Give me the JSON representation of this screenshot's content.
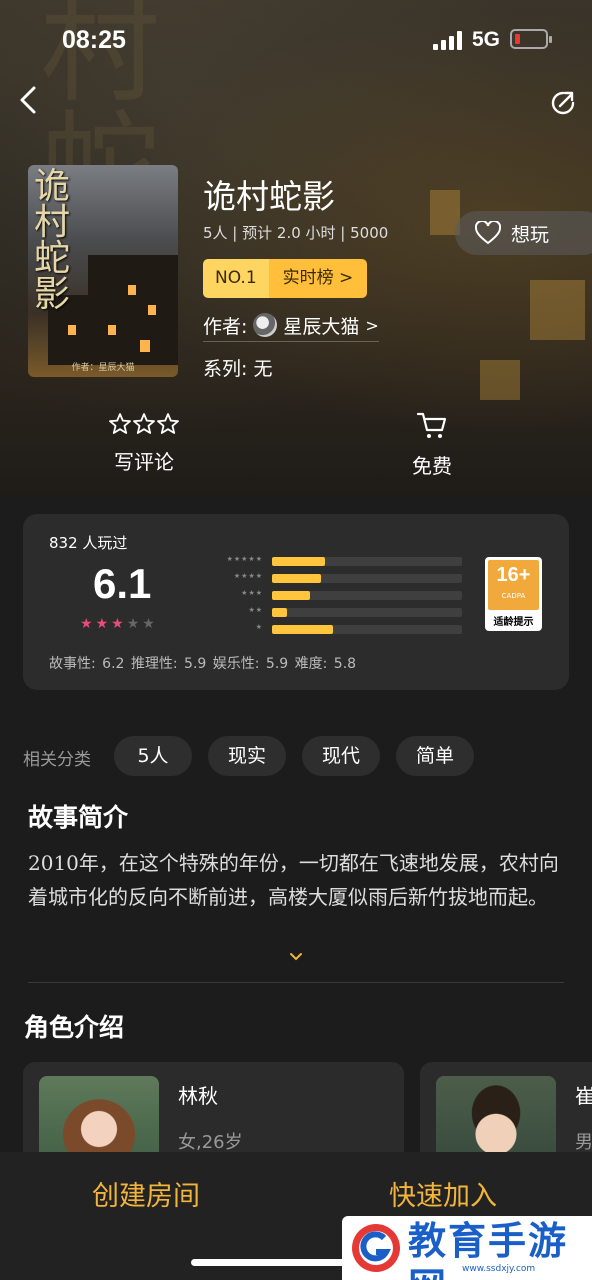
{
  "status_bar": {
    "time": "08:25",
    "network": "5G"
  },
  "game": {
    "title": "诡村蛇影",
    "cover_title": "诡村蛇影",
    "cover_author": "作者：星辰大猫",
    "meta": "5人 | 预计 2.0 小时 | 5000",
    "want_label": "想玩",
    "rank_no": "NO.1",
    "rank_board": "实时榜 >",
    "author_label": "作者:",
    "author_name": "星辰大猫",
    "author_arrow": ">",
    "series": "系列: 无"
  },
  "actions": {
    "review_label": "写评论",
    "price_label": "免费"
  },
  "rating": {
    "players": "832 人玩过",
    "score": "6.1",
    "stars": 3,
    "distribution": [
      {
        "stars": 5,
        "fraction": 0.28
      },
      {
        "stars": 4,
        "fraction": 0.26
      },
      {
        "stars": 3,
        "fraction": 0.2
      },
      {
        "stars": 2,
        "fraction": 0.08
      },
      {
        "stars": 1,
        "fraction": 0.32
      }
    ],
    "age": "16+",
    "age_org": "CADPA",
    "age_tip": "适龄提示",
    "sub_scores": "故事性: 6.2   推理性: 5.9   娱乐性: 5.9   难度: 5.8"
  },
  "categories": {
    "label": "相关分类",
    "tags": [
      "5人",
      "现实",
      "现代",
      "简单"
    ]
  },
  "synopsis": {
    "title": "故事简介",
    "text": "2010年，在这个特殊的年份，一切都在飞速地发展，农村向着城市化的反向不断前进，高楼大厦似雨后新竹拔地而起。"
  },
  "characters": {
    "title": "角色介绍",
    "items": [
      {
        "name": "林秋",
        "info": "女,26岁"
      },
      {
        "name": "崔",
        "info": "男"
      }
    ]
  },
  "bottom": {
    "create_room": "创建房间",
    "quick_join": "快速加入"
  },
  "watermark": {
    "text": "教育手游网",
    "url": "www.ssdxjy.com"
  },
  "colors": {
    "accent": "#f2b43a",
    "rank_yellow": "#ffd561",
    "star_pink": "#e94b7b",
    "bar": "#ffc53d"
  }
}
